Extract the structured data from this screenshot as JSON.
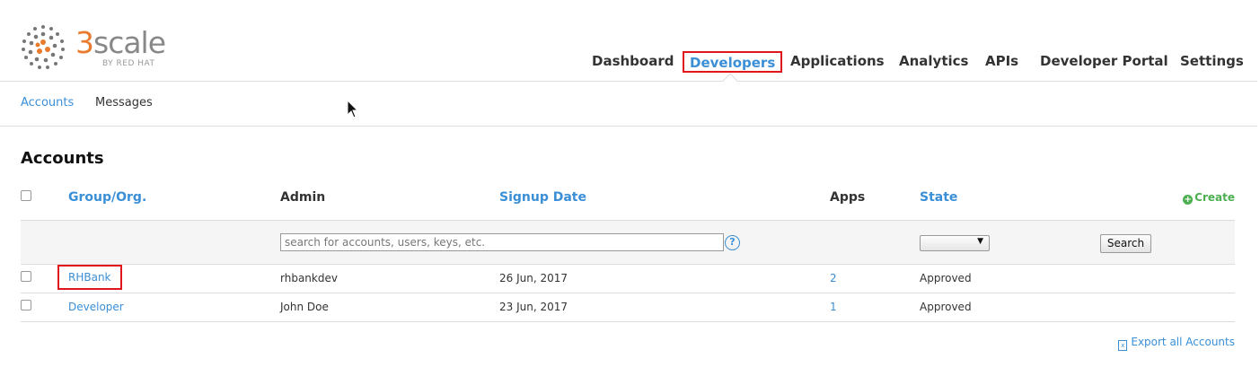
{
  "brand": {
    "wordmark_number": "3",
    "wordmark_text": "scale",
    "byline": "BY RED HAT",
    "accent": "#e87b2e"
  },
  "topnav": {
    "items": [
      {
        "label": "Dashboard"
      },
      {
        "label": "Developers",
        "active": true
      },
      {
        "label": "Applications"
      },
      {
        "label": "Analytics"
      },
      {
        "label": "APIs"
      },
      {
        "label": "Developer Portal"
      },
      {
        "label": "Settings"
      }
    ]
  },
  "subnav": {
    "items": [
      {
        "label": "Accounts",
        "active": true
      },
      {
        "label": "Messages"
      }
    ]
  },
  "page": {
    "title": "Accounts"
  },
  "table": {
    "headers": {
      "group": "Group/Org.",
      "admin": "Admin",
      "signup": "Signup Date",
      "apps": "Apps",
      "state": "State"
    },
    "create_label": "Create",
    "filter": {
      "search_placeholder": "search for accounts, users, keys, etc.",
      "help_glyph": "?",
      "state_value": "",
      "search_button": "Search"
    },
    "rows": [
      {
        "group": "RHBank",
        "admin": "rhbankdev",
        "signup": "26 Jun, 2017",
        "apps": "2",
        "state": "Approved"
      },
      {
        "group": "Developer",
        "admin": "John Doe",
        "signup": "23 Jun, 2017",
        "apps": "1",
        "state": "Approved"
      }
    ]
  },
  "export_label": "Export all Accounts",
  "colors": {
    "link": "#3a8fd6",
    "highlight": "#e0161b",
    "create": "#4caf50"
  }
}
